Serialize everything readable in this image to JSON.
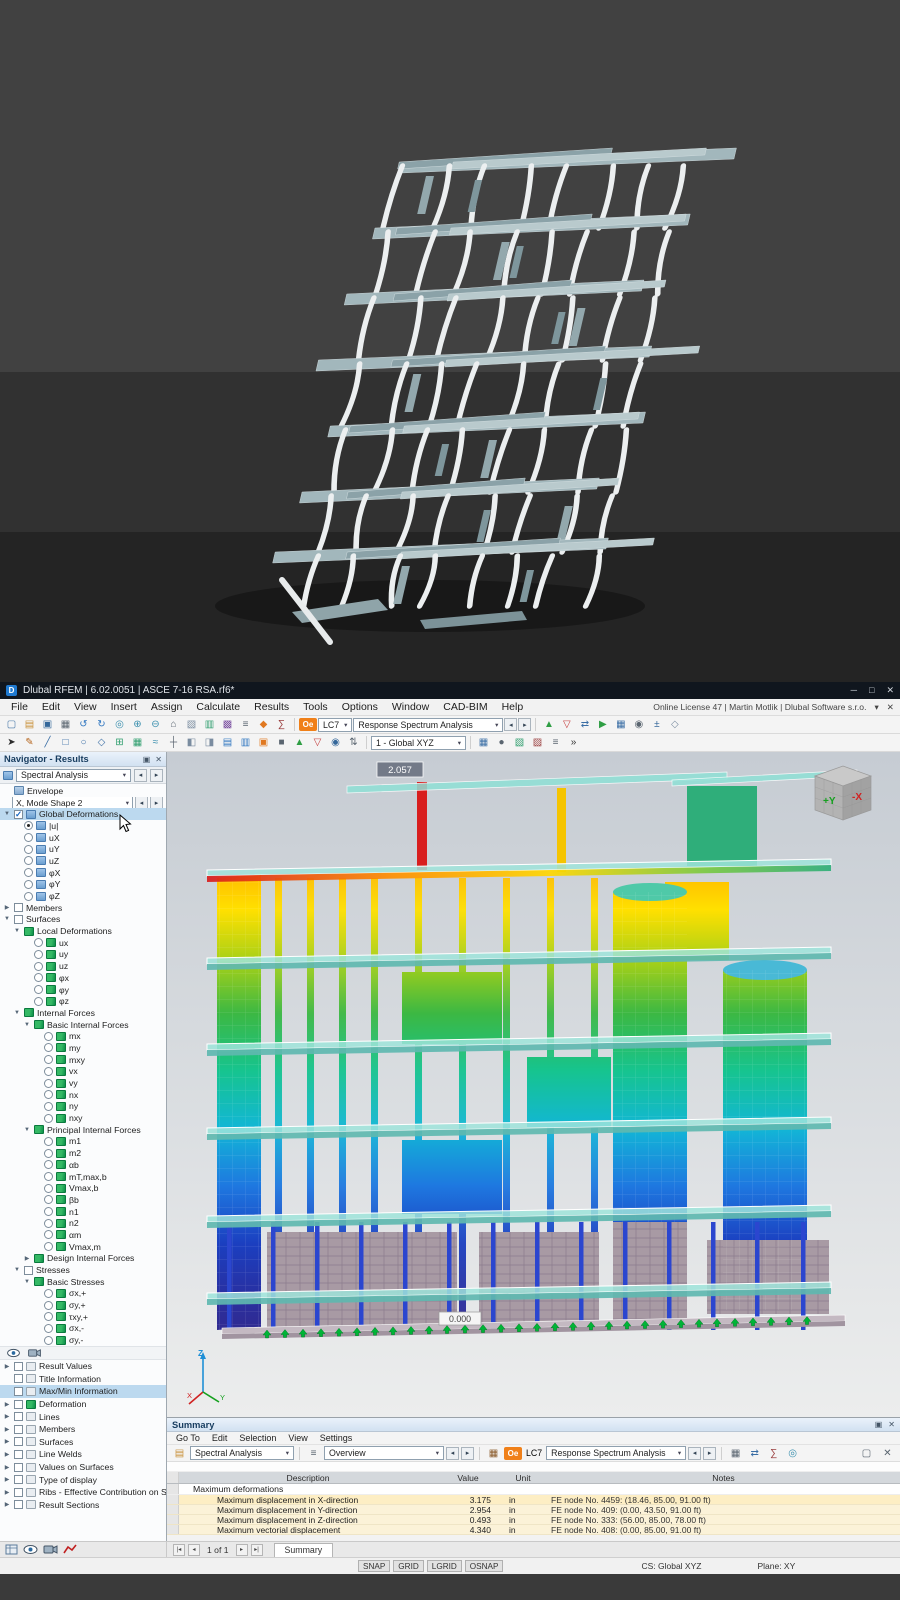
{
  "colors": {
    "accent_blue": "#1f7ad1",
    "lc_orange": "#f08019",
    "selection": "#bcd9ef",
    "support_green": "#00b437",
    "titlebar": "#10161e"
  },
  "window": {
    "title": "Dlubal RFEM | 6.02.0051 | ASCE 7-16 RSA.rf6*"
  },
  "menubar": {
    "items": [
      "File",
      "Edit",
      "View",
      "Insert",
      "Assign",
      "Calculate",
      "Results",
      "Tools",
      "Options",
      "Window",
      "CAD-BIM",
      "Help"
    ],
    "license_text": "Online License 47 | Martin Motlik | Dlubal Software s.r.o."
  },
  "toolbar_main": {
    "badge": "Oe",
    "lc": "LC7",
    "lc_name": "Response Spectrum Analysis",
    "icons_left": [
      {
        "n": "new-model-icon",
        "g": "▢",
        "c": "#4a79a8"
      },
      {
        "n": "open-icon",
        "g": "▤",
        "c": "#c89038"
      },
      {
        "n": "save-icon",
        "g": "▣",
        "c": "#34679a"
      },
      {
        "n": "print-icon",
        "g": "▦",
        "c": "#5a6570"
      },
      {
        "n": "undo-icon",
        "g": "↺",
        "c": "#2f76c0"
      },
      {
        "n": "redo-icon",
        "g": "↻",
        "c": "#2f76c0"
      },
      {
        "n": "zoom-window-icon",
        "g": "◎",
        "c": "#3a8fae"
      },
      {
        "n": "zoom-in-icon",
        "g": "⊕",
        "c": "#3a8fae"
      },
      {
        "n": "zoom-out-icon",
        "g": "⊖",
        "c": "#3a8fae"
      },
      {
        "n": "default-view-icon",
        "g": "⌂",
        "c": "#5a6570"
      },
      {
        "n": "render-mode-icon",
        "g": "▧",
        "c": "#7a8ca0"
      },
      {
        "n": "tables-icon",
        "g": "▥",
        "c": "#2f9e6e"
      },
      {
        "n": "navigator-toggle-icon",
        "g": "▩",
        "c": "#7a4fa0"
      },
      {
        "n": "lists-icon",
        "g": "≡",
        "c": "#5a6570"
      },
      {
        "n": "loads-icon",
        "g": "◆",
        "c": "#e07820"
      },
      {
        "n": "calculate-icon",
        "g": "∑",
        "c": "#9a3e3e"
      }
    ],
    "icons_right": [
      {
        "n": "show-results-icon",
        "g": "▲",
        "c": "#2f9e44"
      },
      {
        "n": "hide-results-icon",
        "g": "▽",
        "c": "#c43b3b"
      },
      {
        "n": "result-tables-icon",
        "g": "⇄",
        "c": "#3a6ea5"
      },
      {
        "n": "animation-icon",
        "g": "▶",
        "c": "#2f9e44"
      },
      {
        "n": "printout-report-icon",
        "g": "▦",
        "c": "#3a6ea5"
      },
      {
        "n": "settings-icon",
        "g": "◉",
        "c": "#5a6570"
      },
      {
        "n": "units-icon",
        "g": "±",
        "c": "#34679a"
      },
      {
        "n": "help-icon",
        "g": "◇",
        "c": "#7a8ca0"
      }
    ]
  },
  "toolbar_view": {
    "combo": "1 - Global XYZ",
    "icons_left": [
      {
        "n": "select-arrow-icon",
        "g": "➤",
        "c": "#2b2b2b"
      },
      {
        "n": "edit-pencil-icon",
        "g": "✎",
        "c": "#b5651d"
      },
      {
        "n": "draw-line-icon",
        "g": "╱",
        "c": "#3a6ea5"
      },
      {
        "n": "draw-rect-icon",
        "g": "□",
        "c": "#3a6ea5"
      },
      {
        "n": "draw-circle-icon",
        "g": "○",
        "c": "#3a6ea5"
      },
      {
        "n": "draw-polygon-icon",
        "g": "◇",
        "c": "#3a6ea5"
      },
      {
        "n": "insert-node-icon",
        "g": "⊞",
        "c": "#2f9e6e"
      },
      {
        "n": "mesh-icon",
        "g": "▦",
        "c": "#2f9e6e"
      },
      {
        "n": "snap-icon",
        "g": "≈",
        "c": "#3a8fae"
      },
      {
        "n": "grid-icon",
        "g": "┼",
        "c": "#5a6570"
      },
      {
        "n": "workplane-xy-icon",
        "g": "◧",
        "c": "#7a8ca0"
      },
      {
        "n": "workplane-yz-icon",
        "g": "◨",
        "c": "#7a8ca0"
      },
      {
        "n": "view-x-icon",
        "g": "▤",
        "c": "#2f76c0"
      },
      {
        "n": "view-y-icon",
        "g": "▥",
        "c": "#2f76c0"
      },
      {
        "n": "view-z-icon",
        "g": "▣",
        "c": "#e07820"
      },
      {
        "n": "solid-view-icon",
        "g": "■",
        "c": "#5a6570"
      },
      {
        "n": "wireframe-icon",
        "g": "▲",
        "c": "#2f9e44"
      },
      {
        "n": "section-icon",
        "g": "▽",
        "c": "#c43b3b"
      },
      {
        "n": "visibility-icon",
        "g": "◉",
        "c": "#34679a"
      },
      {
        "n": "sort-icon",
        "g": "⇅",
        "c": "#5a6570"
      }
    ],
    "icons_right": [
      {
        "n": "full-model-icon",
        "g": "▦",
        "c": "#3a6ea5"
      },
      {
        "n": "user-view-icon",
        "g": "●",
        "c": "#5a6570"
      },
      {
        "n": "clipping-icon",
        "g": "▧",
        "c": "#2f9e6e"
      },
      {
        "n": "measure-icon",
        "g": "▨",
        "c": "#9a3e3e"
      },
      {
        "n": "view-options-icon",
        "g": "≡",
        "c": "#5a6570"
      },
      {
        "n": "more-icon",
        "g": "»",
        "c": "#333333"
      }
    ]
  },
  "navigator": {
    "title": "Navigator - Results",
    "combo_value": "Spectral Analysis",
    "mode_combo": "X, Mode Shape 2",
    "tree": [
      {
        "t": "item",
        "label": "Envelope",
        "icon": "cube"
      },
      {
        "t": "mode"
      },
      {
        "t": "item",
        "label": "Global Deformations",
        "icon": "grid",
        "ctrl": "cb1",
        "exp": "open",
        "sel": true
      },
      {
        "t": "item",
        "label": "|u|",
        "icon": "grid",
        "ctrl": "ron",
        "d": 1
      },
      {
        "t": "item",
        "label": "uX",
        "icon": "grid",
        "ctrl": "r",
        "d": 1
      },
      {
        "t": "item",
        "label": "uY",
        "icon": "grid",
        "ctrl": "r",
        "d": 1
      },
      {
        "t": "item",
        "label": "uZ",
        "icon": "grid",
        "ctrl": "r",
        "d": 1
      },
      {
        "t": "item",
        "label": "φX",
        "icon": "grid",
        "ctrl": "r",
        "d": 1
      },
      {
        "t": "item",
        "label": "φY",
        "icon": "grid",
        "ctrl": "r",
        "d": 1
      },
      {
        "t": "item",
        "label": "φZ",
        "icon": "grid",
        "ctrl": "r",
        "d": 1
      },
      {
        "t": "item",
        "label": "Members",
        "ctrl": "cb0",
        "exp": "closed"
      },
      {
        "t": "item",
        "label": "Surfaces",
        "ctrl": "cb0",
        "exp": "open"
      },
      {
        "t": "item",
        "label": "Local Deformations",
        "icon": "res",
        "exp": "open",
        "d": 1
      },
      {
        "t": "item",
        "label": "ux",
        "icon": "res",
        "ctrl": "r",
        "d": 2
      },
      {
        "t": "item",
        "label": "uy",
        "icon": "res",
        "ctrl": "r",
        "d": 2
      },
      {
        "t": "item",
        "label": "uz",
        "icon": "res",
        "ctrl": "r",
        "d": 2
      },
      {
        "t": "item",
        "label": "φx",
        "icon": "res",
        "ctrl": "r",
        "d": 2
      },
      {
        "t": "item",
        "label": "φy",
        "icon": "res",
        "ctrl": "r",
        "d": 2
      },
      {
        "t": "item",
        "label": "φz",
        "icon": "res",
        "ctrl": "r",
        "d": 2
      },
      {
        "t": "item",
        "label": "Internal Forces",
        "icon": "res",
        "exp": "open",
        "d": 1
      },
      {
        "t": "item",
        "label": "Basic Internal Forces",
        "icon": "res",
        "exp": "open",
        "d": 2
      },
      {
        "t": "item",
        "label": "mx",
        "icon": "res",
        "ctrl": "r",
        "d": 3
      },
      {
        "t": "item",
        "label": "my",
        "icon": "res",
        "ctrl": "r",
        "d": 3
      },
      {
        "t": "item",
        "label": "mxy",
        "icon": "res",
        "ctrl": "r",
        "d": 3
      },
      {
        "t": "item",
        "label": "vx",
        "icon": "res",
        "ctrl": "r",
        "d": 3
      },
      {
        "t": "item",
        "label": "vy",
        "icon": "res",
        "ctrl": "r",
        "d": 3
      },
      {
        "t": "item",
        "label": "nx",
        "icon": "res",
        "ctrl": "r",
        "d": 3
      },
      {
        "t": "item",
        "label": "ny",
        "icon": "res",
        "ctrl": "r",
        "d": 3
      },
      {
        "t": "item",
        "label": "nxy",
        "icon": "res",
        "ctrl": "r",
        "d": 3
      },
      {
        "t": "item",
        "label": "Principal Internal Forces",
        "icon": "res",
        "exp": "open",
        "d": 2
      },
      {
        "t": "item",
        "label": "m1",
        "icon": "res",
        "ctrl": "r",
        "d": 3
      },
      {
        "t": "item",
        "label": "m2",
        "icon": "res",
        "ctrl": "r",
        "d": 3
      },
      {
        "t": "item",
        "label": "αb",
        "icon": "res",
        "ctrl": "r",
        "d": 3
      },
      {
        "t": "item",
        "label": "mT,max,b",
        "icon": "res",
        "ctrl": "r",
        "d": 3
      },
      {
        "t": "item",
        "label": "Vmax,b",
        "icon": "res",
        "ctrl": "r",
        "d": 3
      },
      {
        "t": "item",
        "label": "βb",
        "icon": "res",
        "ctrl": "r",
        "d": 3
      },
      {
        "t": "item",
        "label": "n1",
        "icon": "res",
        "ctrl": "r",
        "d": 3
      },
      {
        "t": "item",
        "label": "n2",
        "icon": "res",
        "ctrl": "r",
        "d": 3
      },
      {
        "t": "item",
        "label": "αm",
        "icon": "res",
        "ctrl": "r",
        "d": 3
      },
      {
        "t": "item",
        "label": "Vmax,m",
        "icon": "res",
        "ctrl": "r",
        "d": 3
      },
      {
        "t": "item",
        "label": "Design Internal Forces",
        "icon": "res",
        "exp": "closed",
        "d": 2
      },
      {
        "t": "item",
        "label": "Stresses",
        "ctrl": "cb0",
        "exp": "open",
        "d": 1
      },
      {
        "t": "item",
        "label": "Basic Stresses",
        "icon": "res",
        "exp": "open",
        "d": 2
      },
      {
        "t": "item",
        "label": "σx,+",
        "icon": "res",
        "ctrl": "r",
        "d": 3
      },
      {
        "t": "item",
        "label": "σy,+",
        "icon": "res",
        "ctrl": "r",
        "d": 3
      },
      {
        "t": "item",
        "label": "τxy,+",
        "icon": "res",
        "ctrl": "r",
        "d": 3
      },
      {
        "t": "item",
        "label": "σx,-",
        "icon": "res",
        "ctrl": "r",
        "d": 3
      },
      {
        "t": "item",
        "label": "σy,-",
        "icon": "res",
        "ctrl": "r",
        "d": 3
      }
    ],
    "bottom_tree": [
      {
        "label": "Result Values",
        "exp": "closed",
        "icon": "doc",
        "ctrl": "cb0"
      },
      {
        "label": "Title Information",
        "icon": "doc",
        "ctrl": "cb0"
      },
      {
        "label": "Max/Min Information",
        "icon": "doc",
        "ctrl": "cb0",
        "sel": true
      },
      {
        "label": "Deformation",
        "exp": "closed",
        "icon": "res",
        "ctrl": "cb0"
      },
      {
        "label": "Lines",
        "exp": "closed",
        "icon": "doc",
        "ctrl": "cb0"
      },
      {
        "label": "Members",
        "exp": "closed",
        "icon": "doc",
        "ctrl": "cb0"
      },
      {
        "label": "Surfaces",
        "exp": "closed",
        "icon": "doc",
        "ctrl": "cb0"
      },
      {
        "label": "Line Welds",
        "exp": "closed",
        "icon": "doc",
        "ctrl": "cb0"
      },
      {
        "label": "Values on Surfaces",
        "exp": "closed",
        "icon": "doc",
        "ctrl": "cb0"
      },
      {
        "label": "Type of display",
        "exp": "closed",
        "icon": "doc",
        "ctrl": "cb0"
      },
      {
        "label": "Ribs - Effective Contribution on Surface...",
        "exp": "closed",
        "icon": "doc",
        "ctrl": "cb0"
      },
      {
        "label": "Result Sections",
        "exp": "closed",
        "icon": "doc",
        "ctrl": "cb0"
      }
    ]
  },
  "viewport": {
    "max_value": "2.057",
    "min_value": "0.000",
    "cube_y": "+Y",
    "cube_x": "-X",
    "axis_z": "Z",
    "axis_x": "X",
    "axis_y": "Y"
  },
  "summary": {
    "title": "Summary",
    "menu": [
      "Go To",
      "Edit",
      "Selection",
      "View",
      "Settings"
    ],
    "combo1": "Spectral Analysis",
    "combo2": "Overview",
    "badge": "Oe",
    "lc": "LC7",
    "lc_name": "Response Spectrum Analysis",
    "headers": [
      "Description",
      "Value",
      "Unit",
      "Notes"
    ],
    "section": "Maximum deformations",
    "rows": [
      {
        "desc": "Maximum displacement in X-direction",
        "val": "3.175",
        "unit": "in",
        "notes": "FE node No. 4459: (18.46, 85.00, 91.00 ft)"
      },
      {
        "desc": "Maximum displacement in Y-direction",
        "val": "2.954",
        "unit": "in",
        "notes": "FE node No. 409: (0.00, 43.50, 91.00 ft)"
      },
      {
        "desc": "Maximum displacement in Z-direction",
        "val": "0.493",
        "unit": "in",
        "notes": "FE node No. 333: (56.00, 85.00, 78.00 ft)"
      },
      {
        "desc": "Maximum vectorial displacement",
        "val": "4.340",
        "unit": "in",
        "notes": "FE node No. 408: (0.00, 85.00, 91.00 ft)"
      }
    ]
  },
  "tabrow": {
    "pager": "1 of 1",
    "tab": "Summary"
  },
  "statusbar": {
    "toggles": [
      "SNAP",
      "GRID",
      "LGRID",
      "OSNAP"
    ],
    "cs": "CS: Global XYZ",
    "plane": "Plane: XY"
  }
}
